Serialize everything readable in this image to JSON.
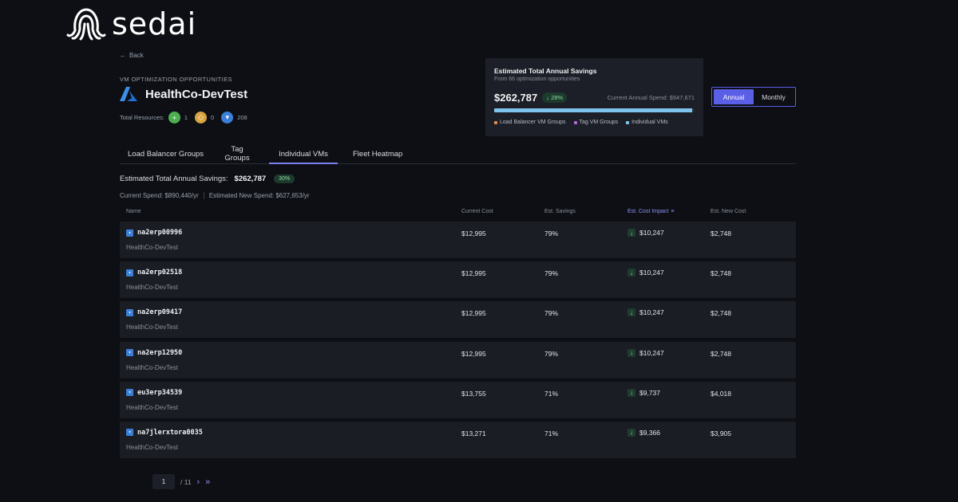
{
  "brand": {
    "name": "sedai"
  },
  "nav": {
    "back_label": "Back"
  },
  "header": {
    "kicker": "VM OPTIMIZATION OPPORTUNITIES",
    "title": "HealthCo-DevTest",
    "resources_label": "Total Resources:",
    "resources": [
      {
        "icon": "plus-icon",
        "count": "1",
        "color": "#4caf50"
      },
      {
        "icon": "tag-icon",
        "count": "0",
        "color": "#d9a441"
      },
      {
        "icon": "vm-icon",
        "count": "208",
        "color": "#3b7fd6"
      }
    ]
  },
  "savings_card": {
    "title": "Estimated Total Annual Savings",
    "subtitle": "From 66 optimization opportunities",
    "amount": "$262,787",
    "pct": "28%",
    "current_spend": "Current Annual Spend: $947,671",
    "bar_fill_fraction": 0.99,
    "legend": [
      {
        "label": "Load Balancer VM Groups",
        "color": "#e8894a"
      },
      {
        "label": "Tag VM Groups",
        "color": "#b06ad9"
      },
      {
        "label": "Individual VMs",
        "color": "#7fc4ec"
      }
    ]
  },
  "period_toggle": {
    "annual": "Annual",
    "monthly": "Monthly",
    "selected": "Annual"
  },
  "tabs": [
    {
      "label": "Load Balancer Groups"
    },
    {
      "label": "Tag Groups"
    },
    {
      "label": "Individual VMs",
      "active": true
    },
    {
      "label": "Fleet Heatmap"
    }
  ],
  "summary": {
    "label": "Estimated Total Annual Savings:",
    "amount": "$262,787",
    "pct": "30%",
    "current_spend": "Current Spend: $890,440/yr",
    "new_spend": "Estimated New Spend: $627,653/yr"
  },
  "table": {
    "columns": {
      "name": "Name",
      "current_cost": "Current Cost",
      "est_savings": "Est. Savings",
      "est_cost_impact": "Est. Cost Impact",
      "est_new_cost": "Est. New Cost"
    },
    "rows": [
      {
        "name": "na2erp00996",
        "group": "HealthCo-DevTest",
        "current_cost": "$12,995",
        "est_savings": "79%",
        "impact": "$10,247",
        "new_cost": "$2,748"
      },
      {
        "name": "na2erp02518",
        "group": "HealthCo-DevTest",
        "current_cost": "$12,995",
        "est_savings": "79%",
        "impact": "$10,247",
        "new_cost": "$2,748"
      },
      {
        "name": "na2erp09417",
        "group": "HealthCo-DevTest",
        "current_cost": "$12,995",
        "est_savings": "79%",
        "impact": "$10,247",
        "new_cost": "$2,748"
      },
      {
        "name": "na2erp12950",
        "group": "HealthCo-DevTest",
        "current_cost": "$12,995",
        "est_savings": "79%",
        "impact": "$10,247",
        "new_cost": "$2,748"
      },
      {
        "name": "eu3erp34539",
        "group": "HealthCo-DevTest",
        "current_cost": "$13,755",
        "est_savings": "71%",
        "impact": "$9,737",
        "new_cost": "$4,018"
      },
      {
        "name": "na7jlerxtora0035",
        "group": "HealthCo-DevTest",
        "current_cost": "$13,271",
        "est_savings": "71%",
        "impact": "$9,366",
        "new_cost": "$3,905"
      }
    ]
  },
  "pagination": {
    "current": "1",
    "total": "/ 11"
  }
}
